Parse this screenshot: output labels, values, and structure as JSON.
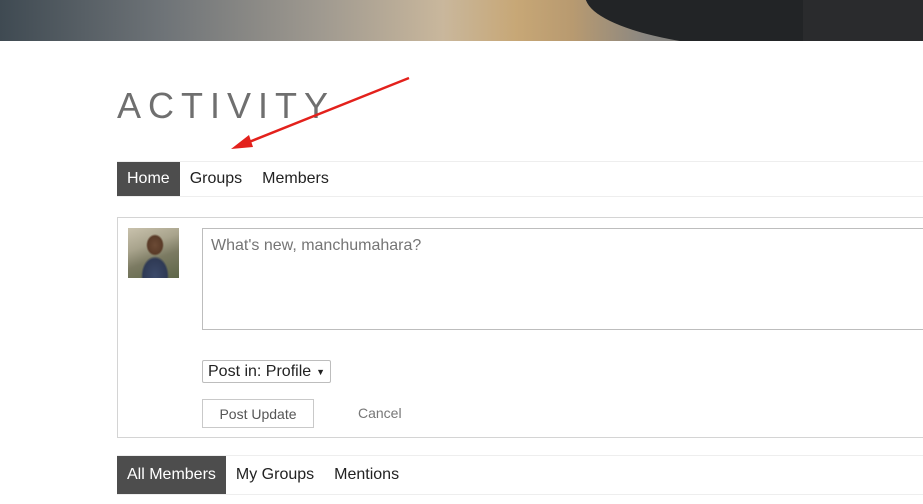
{
  "page": {
    "title": "ACTIVITY"
  },
  "main_tabs": [
    {
      "label": "Home",
      "active": true
    },
    {
      "label": "Groups",
      "active": false
    },
    {
      "label": "Members",
      "active": false
    }
  ],
  "post_form": {
    "textarea_placeholder": "What's new, manchumahara?",
    "post_in_label": "Post in: Profile",
    "submit_label": "Post Update",
    "cancel_label": "Cancel"
  },
  "filter_tabs": [
    {
      "label": "All Members",
      "active": true
    },
    {
      "label": "My Groups",
      "active": false
    },
    {
      "label": "Mentions",
      "active": false
    }
  ],
  "icons": {
    "dropdown": "caret-down-icon",
    "annotation": "red-arrow-annotation"
  },
  "colors": {
    "active_tab_bg": "#4d4d4d",
    "annotation_red": "#e3211c",
    "title_gray": "#6f6f6f"
  }
}
